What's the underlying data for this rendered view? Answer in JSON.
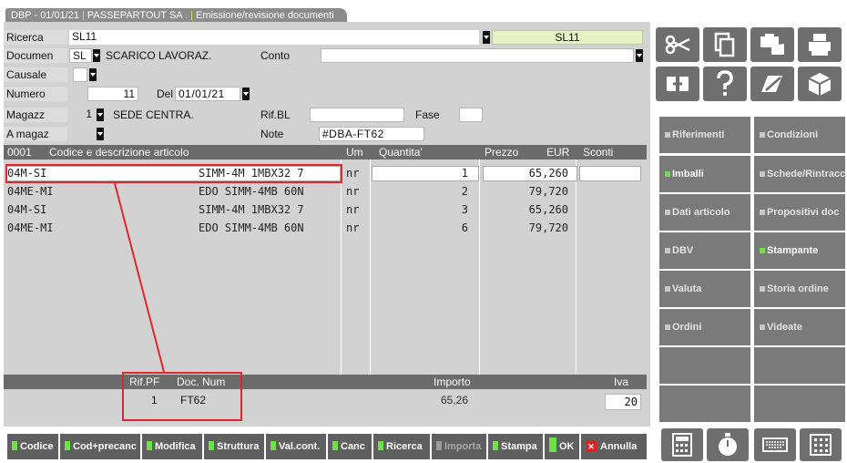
{
  "title": {
    "part1": "DBP - 01/01/21",
    "part2": "PASSEPARTOUT SA .",
    "part3": "Emissione/revisione documenti"
  },
  "form": {
    "ricerca_label": "Ricerca",
    "ricerca_value": "SL11",
    "ricerca_code": "SL11",
    "documen_label": "Documen",
    "documen_value": "SL",
    "documen_desc": "SCARICO LAVORAZ.",
    "conto_label": "Conto",
    "conto_value": "",
    "causale_label": "Causale",
    "causale_value": "",
    "numero_label": "Numero",
    "numero_value": "11",
    "del_label": "Del",
    "del_value": "01/01/21",
    "magazz_label": "Magazz",
    "magazz_value": "1",
    "magazz_desc": "SEDE CENTRA.",
    "rifbl_label": "Rif.BL",
    "rifbl_value": "",
    "fase_label": "Fase",
    "fase_value": "",
    "amagaz_label": "A magaz",
    "amagaz_value": "",
    "note_label": "Note",
    "note_value": "#DBA-FT62"
  },
  "grid": {
    "headers": {
      "code": "0001",
      "desc": "Codice e descrizione articolo",
      "um": "Um",
      "qta": "Quantita'",
      "prezzo": "Prezzo",
      "eur": "EUR",
      "sconti": "Sconti"
    },
    "rows": [
      {
        "code": "04M-SI",
        "desc": "SIMM-4M 1MBX32 7",
        "um": "nr",
        "qta": "1",
        "prezzo": "65,260",
        "sconti": ""
      },
      {
        "code": "04ME-MI",
        "desc": "EDO SIMM-4MB 60N",
        "um": "nr",
        "qta": "2",
        "prezzo": "79,720",
        "sconti": ""
      },
      {
        "code": "04M-SI",
        "desc": "SIMM-4M 1MBX32 7",
        "um": "nr",
        "qta": "3",
        "prezzo": "65,260",
        "sconti": ""
      },
      {
        "code": "04ME-MI",
        "desc": "EDO SIMM-4MB 60N",
        "um": "nr",
        "qta": "6",
        "prezzo": "79,720",
        "sconti": ""
      }
    ]
  },
  "footer": {
    "rifpf_label": "Rif.PF",
    "docnum_label": "Doc. Num",
    "importo_label": "Importo",
    "iva_label": "Iva",
    "rifpf_value": "1",
    "docnum_value": "FT62",
    "importo_value": "65,26",
    "iva_value": "20"
  },
  "sidebuttons": [
    {
      "label": "Riferimenti",
      "state": "normal"
    },
    {
      "label": "Condizioni",
      "state": "normal"
    },
    {
      "label": "Imballi",
      "state": "active"
    },
    {
      "label": "Schede/Rintracc.",
      "state": "normal"
    },
    {
      "label": "Dati articolo",
      "state": "normal"
    },
    {
      "label": "Propositivi doc",
      "state": "normal"
    },
    {
      "label": "DBV",
      "state": "normal"
    },
    {
      "label": "Stampante",
      "state": "active"
    },
    {
      "label": "Valuta",
      "state": "normal"
    },
    {
      "label": "Storia ordine",
      "state": "normal"
    },
    {
      "label": "Ordini",
      "state": "normal"
    },
    {
      "label": "Videate",
      "state": "normal"
    }
  ],
  "toolbar_icons": [
    "scissors-icon",
    "copy-icon",
    "paste-icon",
    "printer-icon",
    "transfer-icon",
    "help-icon",
    "edit-notes-icon",
    "box-icon"
  ],
  "bottom_icons": [
    "calculator-icon",
    "timer-icon",
    "keyboard-icon",
    "grid-icon"
  ],
  "bottombar": {
    "codice": "Codice",
    "codprecanc": "Cod+precanc",
    "modifica": "Modifica",
    "struttura": "Struttura",
    "valcont": "Val.cont.",
    "canc": "Canc",
    "ricerca": "Ricerca",
    "importa": "Importa",
    "stampa": "Stampa",
    "ok": "OK",
    "annulla": "Annulla"
  },
  "colors": {
    "accent_green": "#6ee04a",
    "annotation_red": "#e0282c",
    "panel_gray": "#d2d2d2",
    "header_gray": "#6b6b6b"
  }
}
